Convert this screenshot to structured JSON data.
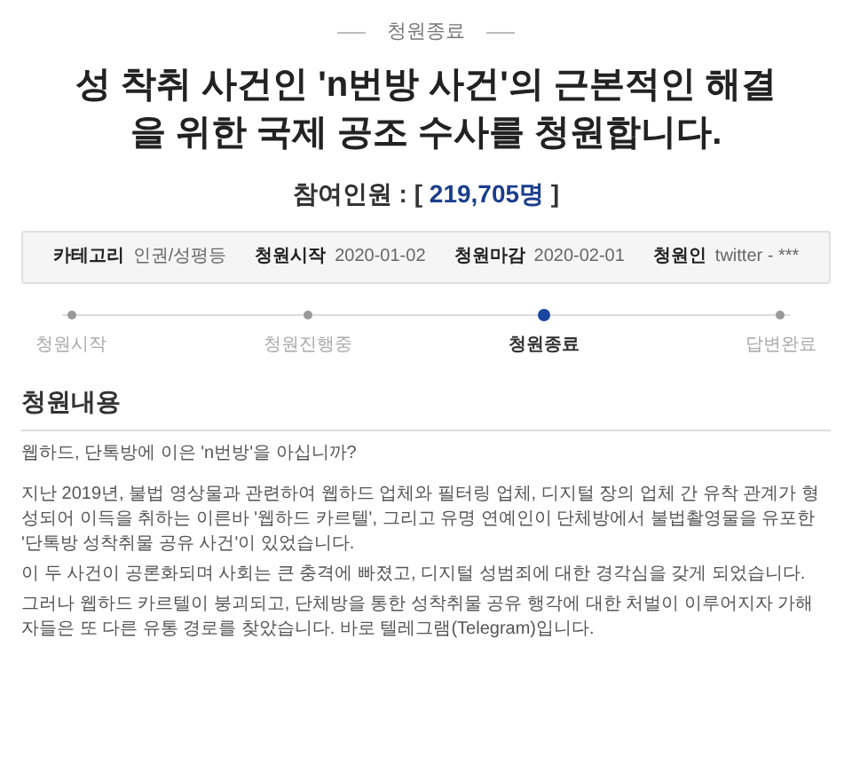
{
  "status_label": "청원종료",
  "title": "성 착취 사건인 'n번방 사건'의 근본적인 해결을 위한 국제 공조 수사를 청원합니다.",
  "participants": {
    "prefix": "참여인원 : [",
    "count": "219,705명",
    "suffix": "]"
  },
  "info": [
    {
      "label": "카테고리",
      "value": "인권/성평등"
    },
    {
      "label": "청원시작",
      "value": "2020-01-02"
    },
    {
      "label": "청원마감",
      "value": "2020-02-01"
    },
    {
      "label": "청원인",
      "value": "twitter - ***"
    }
  ],
  "steps": [
    {
      "label": "청원시작",
      "selected": false
    },
    {
      "label": "청원진행중",
      "selected": false
    },
    {
      "label": "청원종료",
      "selected": true
    },
    {
      "label": "답변완료",
      "selected": false
    }
  ],
  "content": {
    "heading": "청원내용",
    "paragraphs": [
      "웹하드, 단톡방에 이은 'n번방'을 아십니까?",
      "지난 2019년, 불법 영상물과 관련하여 웹하드 업체와 필터링 업체, 디지털 장의 업체 간 유착 관계가 형성되어 이득을 취하는 이른바 '웹하드 카르텔', 그리고 유명 연예인이 단체방에서 불법촬영물을 유포한 '단톡방 성착취물 공유 사건'이 있었습니다.",
      "이 두 사건이 공론화되며 사회는 큰 충격에 빠졌고, 디지털 성범죄에 대한 경각심을 갖게 되었습니다.",
      "그러나 웹하드 카르텔이 붕괴되고, 단체방을 통한 성착취물 공유 행각에 대한 처벌이 이루어지자 가해자들은 또 다른 유통 경로를 찾았습니다. 바로 텔레그램(Telegram)입니다."
    ]
  }
}
